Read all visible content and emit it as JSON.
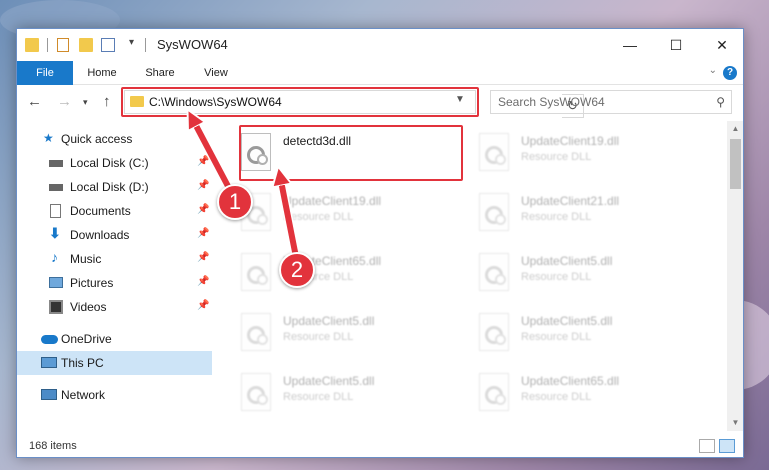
{
  "window": {
    "title": "SysWOW64",
    "minimize": "—",
    "maximize": "☐",
    "close": "✕"
  },
  "ribbon": {
    "tabs": [
      "File",
      "Home",
      "Share",
      "View"
    ],
    "help": "?"
  },
  "address": {
    "path": "C:\\Windows\\SysWOW64",
    "search_placeholder": "Search SysWOW64"
  },
  "sidebar": {
    "items": [
      {
        "label": "Quick access",
        "icon": "star-icon",
        "pinned": false
      },
      {
        "label": "Local Disk (C:)",
        "icon": "drive-icon",
        "pinned": true
      },
      {
        "label": "Local Disk (D:)",
        "icon": "drive-icon",
        "pinned": true
      },
      {
        "label": "Documents",
        "icon": "documents-icon",
        "pinned": true
      },
      {
        "label": "Downloads",
        "icon": "download-icon",
        "pinned": true
      },
      {
        "label": "Music",
        "icon": "music-icon",
        "pinned": true
      },
      {
        "label": "Pictures",
        "icon": "pictures-icon",
        "pinned": true
      },
      {
        "label": "Videos",
        "icon": "videos-icon",
        "pinned": true
      },
      {
        "label": "OneDrive",
        "icon": "cloud-icon",
        "pinned": false
      },
      {
        "label": "This PC",
        "icon": "computer-icon",
        "pinned": false,
        "selected": true
      },
      {
        "label": "Network",
        "icon": "network-icon",
        "pinned": false
      }
    ]
  },
  "files": [
    {
      "name": "detectd3d.dll",
      "type": ""
    },
    {
      "name": "UpdateClient19.dll",
      "type": "Resource DLL"
    },
    {
      "name": "UpdateClient19.dll",
      "type": "Resource DLL"
    },
    {
      "name": "UpdateClient21.dll",
      "type": "Resource DLL"
    },
    {
      "name": "UpdateClient65.dll",
      "type": "Resource DLL"
    },
    {
      "name": "UpdateClient5.dll",
      "type": "Resource DLL"
    },
    {
      "name": "UpdateClient5.dll",
      "type": "Resource DLL"
    },
    {
      "name": "UpdateClient5.dll",
      "type": "Resource DLL"
    },
    {
      "name": "UpdateClient5.dll",
      "type": "Resource DLL"
    },
    {
      "name": "UpdateClient65.dll",
      "type": "Resource DLL"
    }
  ],
  "status": {
    "count": "168 items"
  },
  "annotations": {
    "step1": "1",
    "step2": "2",
    "accent": "#e2333c"
  }
}
